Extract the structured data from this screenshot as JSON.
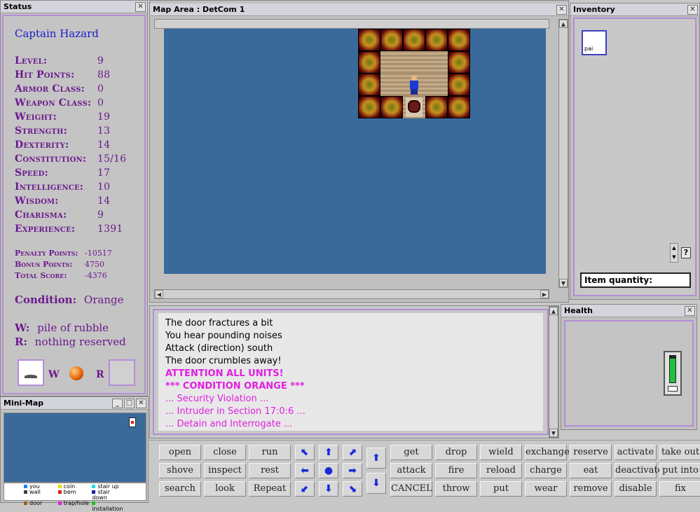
{
  "status": {
    "title": "Status",
    "player_name": "Captain Hazard",
    "stats": [
      {
        "label": "Level:",
        "value": "9"
      },
      {
        "label": "Hit Points:",
        "value": "88"
      },
      {
        "label": "Armor Class:",
        "value": "0"
      },
      {
        "label": "Weapon Class:",
        "value": "0"
      },
      {
        "label": "Weight:",
        "value": "19"
      },
      {
        "label": "Strength:",
        "value": "13"
      },
      {
        "label": "Dexterity:",
        "value": "14"
      },
      {
        "label": "Constitution:",
        "value": "15/16"
      },
      {
        "label": "Speed:",
        "value": "17"
      },
      {
        "label": "Intelligence:",
        "value": "10"
      },
      {
        "label": "Wisdom:",
        "value": "14"
      },
      {
        "label": "Charisma:",
        "value": "9"
      },
      {
        "label": "Experience:",
        "value": "1391"
      }
    ],
    "scores": [
      {
        "label": "Penalty Points:",
        "value": "-10517"
      },
      {
        "label": "Bonus Points:",
        "value": "4750"
      },
      {
        "label": "Total Score:",
        "value": "-4376"
      }
    ],
    "condition_label": "Condition:",
    "condition_value": "Orange",
    "wield_label": "W:",
    "wield_value": "pile of rubble",
    "reserve_label": "R:",
    "reserve_value": "nothing reserved",
    "slot_w": "W",
    "slot_r": "R",
    "accent_color": "#b48cd8",
    "text_color": "#6b1a8c"
  },
  "map": {
    "title": "Map Area : DetCom 1",
    "bg_color": "#3a6a9a"
  },
  "inventory": {
    "title": "Inventory",
    "item_label": "pai",
    "quantity_label": "Item quantity:",
    "help": "?"
  },
  "messages": [
    {
      "text": "The door fractures a bit",
      "style": "black"
    },
    {
      "text": "You hear pounding noises",
      "style": "black"
    },
    {
      "text": "Attack (direction) south",
      "style": "black"
    },
    {
      "text": "The door crumbles away!",
      "style": "black"
    },
    {
      "text": "ATTENTION ALL UNITS!",
      "style": "pink"
    },
    {
      "text": "*** CONDITION ORANGE ***",
      "style": "pink"
    },
    {
      "text": "... Security Violation ...",
      "style": "pinkn"
    },
    {
      "text": "... Intruder in Section 17:0:6 ...",
      "style": "pinkn"
    },
    {
      "text": "... Detain and Interrogate ...",
      "style": "pinkn"
    }
  ],
  "health": {
    "title": "Health",
    "level": 0.9
  },
  "minimap": {
    "title": "Mini-Map",
    "legend": [
      {
        "label": "you",
        "color": "#2080ff"
      },
      {
        "label": "coin",
        "color": "#e0e000"
      },
      {
        "label": "stair up",
        "color": "#20e0e0"
      },
      {
        "label": "wall",
        "color": "#404040"
      },
      {
        "label": "bem",
        "color": "#e02020"
      },
      {
        "label": "stair down",
        "color": "#2020a0"
      },
      {
        "label": "door",
        "color": "#a06020"
      },
      {
        "label": "trap/hole",
        "color": "#e020e0"
      },
      {
        "label": "installation",
        "color": "#20c020"
      }
    ]
  },
  "commands": {
    "left": [
      [
        "open",
        "close",
        "run"
      ],
      [
        "shove",
        "inspect",
        "rest"
      ],
      [
        "search",
        "look",
        "Repeat"
      ]
    ],
    "right": [
      [
        "get",
        "drop",
        "wield",
        "exchange",
        "reserve",
        "activate",
        "take out"
      ],
      [
        "attack",
        "fire",
        "reload",
        "charge",
        "eat",
        "deactivate",
        "put into"
      ],
      [
        "CANCEL",
        "throw",
        "put",
        "wear",
        "remove",
        "disable",
        "fix"
      ]
    ]
  }
}
